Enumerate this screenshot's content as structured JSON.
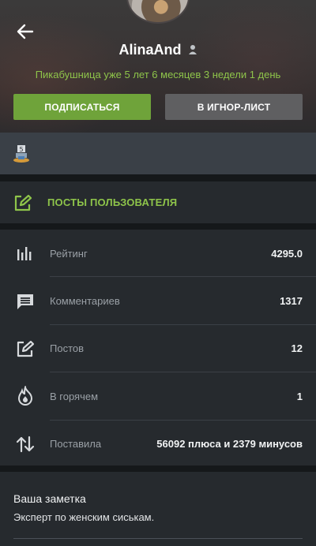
{
  "profile": {
    "username": "AlinaAnd",
    "tenure": "Пикабушница уже 5 лет 6 месяцев 3 недели 1 день",
    "subscribe_label": "ПОДПИСАТЬСЯ",
    "ignore_label": "В ИГНОР-ЛИСТ"
  },
  "posts_link": {
    "label": "ПОСТЫ ПОЛЬЗОВАТЕЛЯ"
  },
  "stats": [
    {
      "label": "Рейтинг",
      "value": "4295.0",
      "icon": "rating-icon"
    },
    {
      "label": "Комментариев",
      "value": "1317",
      "icon": "comment-icon"
    },
    {
      "label": "Постов",
      "value": "12",
      "icon": "edit-icon"
    },
    {
      "label": "В горячем",
      "value": "1",
      "icon": "fire-icon"
    },
    {
      "label": "Поставила",
      "value": "56092 плюса и 2379 минусов",
      "icon": "votes-icon"
    }
  ],
  "note": {
    "title": "Ваша заметка",
    "text": "Эксперт по женским сиськам."
  },
  "colors": {
    "accent_green": "#8ec44a",
    "subscribe_bg": "#6fa33a",
    "ignore_bg": "#5f5f61",
    "panel_bg": "#262a2e"
  }
}
